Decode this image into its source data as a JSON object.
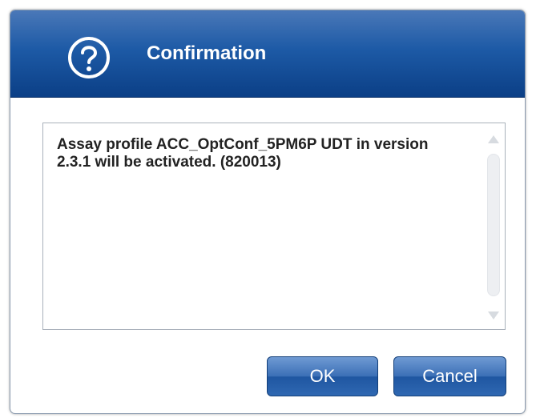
{
  "dialog": {
    "title": "Confirmation",
    "icon": "question-help-icon",
    "message": "Assay profile ACC_OptConf_5PM6P UDT in version 2.3.1 will be activated. (820013)",
    "buttons": {
      "ok_label": "OK",
      "cancel_label": "Cancel"
    },
    "colors": {
      "titlebar_top": "#4a78b8",
      "titlebar_bottom": "#0b3f86",
      "button_blue": "#2f68b2",
      "message_text": "#222222"
    }
  }
}
